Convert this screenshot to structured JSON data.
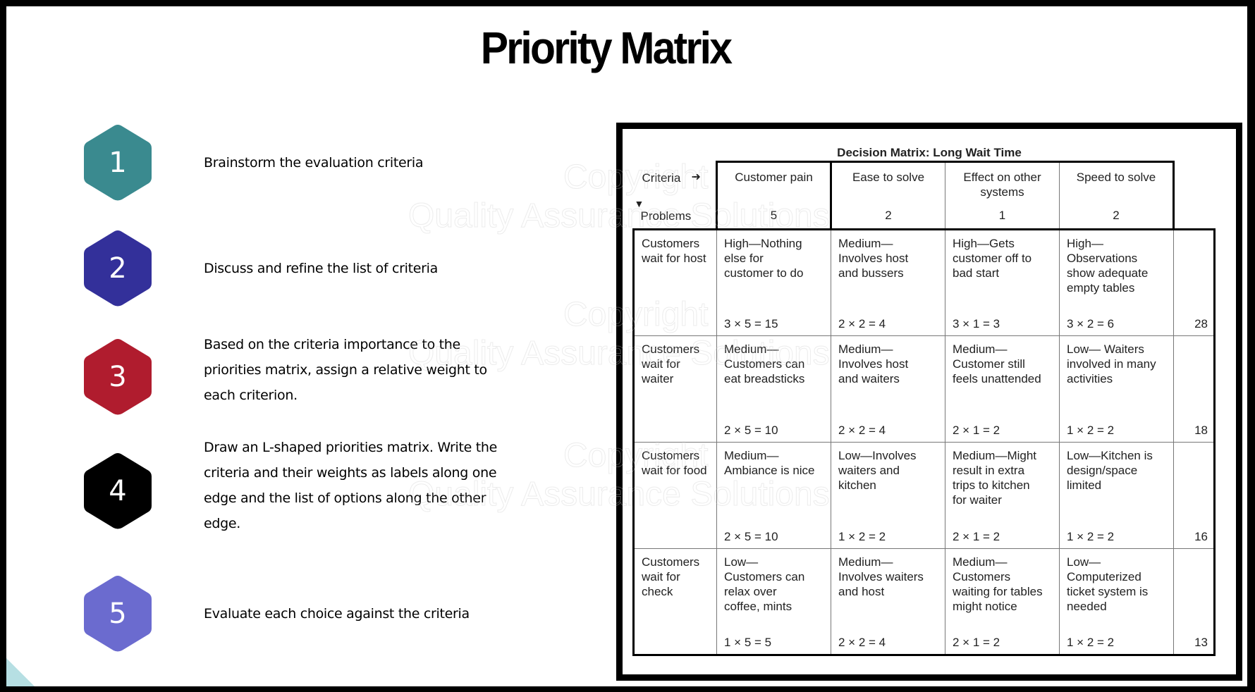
{
  "slide": {
    "title": "Priority Matrix",
    "steps": [
      {
        "number": "1",
        "color": "#3a8a8f",
        "text": "Brainstorm the evaluation criteria"
      },
      {
        "number": "2",
        "color": "#33309a",
        "text": "Discuss and refine the list of criteria"
      },
      {
        "number": "3",
        "color": "#b01c2e",
        "text": "Based on the criteria importance to the priorities matrix, assign a relative weight to each criterion."
      },
      {
        "number": "4",
        "color": "#000000",
        "text": "Draw an L-shaped priorities matrix. Write the criteria and their weights as labels along one edge and the list of options along the other edge."
      },
      {
        "number": "5",
        "color": "#6b6bcf",
        "text": "Evaluate each choice against the criteria"
      }
    ],
    "watermark": [
      "Copyright",
      "Quality Assurance Solutions"
    ]
  },
  "matrix": {
    "title": "Decision Matrix: Long Wait Time",
    "criteria_label": "Criteria",
    "problems_label": "Problems",
    "criteria": [
      {
        "name": "Customer pain",
        "weight": "5"
      },
      {
        "name": "Ease to solve",
        "weight": "2"
      },
      {
        "name": "Effect on other systems",
        "weight": "1"
      },
      {
        "name": "Speed to solve",
        "weight": "2"
      }
    ],
    "rows": [
      {
        "problem": "Customers wait for host",
        "cells": [
          {
            "desc": "High—Nothing else for customer to do",
            "score": "3 × 5 = 15"
          },
          {
            "desc": "Medium—Involves host and bussers",
            "score": "2 × 2 = 4"
          },
          {
            "desc": "High—Gets customer off to bad start",
            "score": "3 × 1 = 3"
          },
          {
            "desc": "High—Observations show adequate empty tables",
            "score": "3 × 2 = 6"
          }
        ],
        "total": "28"
      },
      {
        "problem": "Customers wait for waiter",
        "cells": [
          {
            "desc": "Medium—Customers can eat breadsticks",
            "score": "2 × 5 = 10"
          },
          {
            "desc": "Medium—Involves host and waiters",
            "score": "2 × 2 = 4"
          },
          {
            "desc": "Medium—Customer still feels unattended",
            "score": "2 × 1 = 2"
          },
          {
            "desc": "Low— Waiters involved in many activities",
            "score": "1 × 2 = 2"
          }
        ],
        "total": "18"
      },
      {
        "problem": "Customers wait for food",
        "cells": [
          {
            "desc": "Medium—Ambiance is nice",
            "score": "2 × 5 = 10"
          },
          {
            "desc": "Low—Involves waiters and kitchen",
            "score": "1 × 2 = 2"
          },
          {
            "desc": "Medium—Might result in extra trips to kitchen for waiter",
            "score": "2 × 1 = 2"
          },
          {
            "desc": "Low—Kitchen is design/space limited",
            "score": "1 × 2 = 2"
          }
        ],
        "total": "16"
      },
      {
        "problem": "Customers wait for check",
        "cells": [
          {
            "desc": "Low—Customers can relax over coffee, mints",
            "score": "1 × 5 = 5"
          },
          {
            "desc": "Medium—Involves waiters and host",
            "score": "2 × 2 = 4"
          },
          {
            "desc": "Medium—Customers waiting for tables might notice",
            "score": "2 × 1 = 2"
          },
          {
            "desc": "Low—Computerized ticket system is needed",
            "score": "1 × 2 = 2"
          }
        ],
        "total": "13"
      }
    ]
  }
}
